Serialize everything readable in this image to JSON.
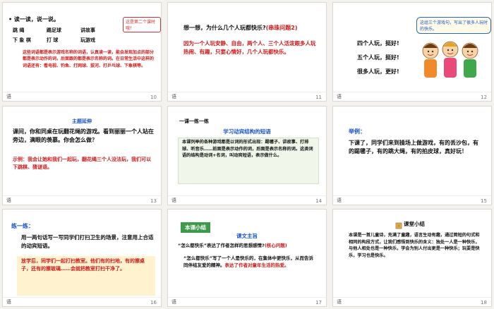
{
  "slides": [
    {
      "page": "10",
      "footer": "语",
      "heading": "• 读一读，说一说。",
      "corner_tag": "这是第二个课时哦！",
      "words_row1": [
        "跳 绳",
        "踢足球",
        "讲故事"
      ],
      "words_row2": [
        "下 象 棋",
        "打 球",
        "玩游戏"
      ],
      "explanation": "这些词语都是表示游戏名称的词语，认真读一读，能会发现加点的部分都是表示动作的词，后面跟的都是表示名称的词。在日常生活中这样的词语还有：看电视、钓鱼、打网球、拔河、打乒乓球、下象棋等。"
    },
    {
      "page": "11",
      "footer": "语",
      "question": "想一想，为什么几个人玩都快乐?",
      "question_tag": "(串珠问题2)",
      "answer": "因为一个人玩安静、自由，两个人、三个人活泼跟多人玩热闹、有趣，只要心情好，几个人玩都快乐。"
    },
    {
      "page": "12",
      "footer": "语",
      "bubble": "这组三个游戏句，写出了很多人玩时的快乐。",
      "lines": [
        "四个人玩，挺好!",
        "五个人玩，挺好!",
        "很多人玩，更好!"
      ]
    },
    {
      "page": "13",
      "footer": "语",
      "title": "主题延伸",
      "body": "课间，你和同桌在玩翻花绳的游戏。看到丽丽一个人站在旁边，满眼的羡慕。你会怎么做？",
      "example": "示例：我会让她和我们一起玩，翻花绳三个人没法玩，我们可以下跳棋、猜谜语。"
    },
    {
      "page": "14",
      "footer": "语",
      "strip": "一课一练一练",
      "title": "学习动宾结构的短语",
      "body": "本课列举的各种游戏都是以词的形式出现：踢毽子、讲故事、打排球、听音乐……前面是表示动作的词，后面是表示名称的词。这类词语的结构是动词+名词，叫动宾短语，表示做什么。"
    },
    {
      "page": "15",
      "footer": "语",
      "label": "举例：",
      "body": "下课了，同学们来到操场上做游戏，有的丢沙包，有的踢毽子，有的跳大绳，有的拍皮球，真好玩！"
    },
    {
      "page": "16",
      "footer": "语",
      "label": "练一练：",
      "prompt": "用一两句话写一写同学们打扫卫生的场景，注意用上合适的动宾短语。",
      "answer": "放学后，同学们一起打扫教室。他们有的扫地，有的擦桌子，还有的擦玻璃……会就把教室打扫干净了。"
    },
    {
      "page": "17",
      "footer": "语",
      "badge": "本课小结",
      "subtitle": "课文主旨",
      "question": "“怎么都快乐”表达了作者怎样的思想感情?",
      "question_tag": "(核心问题)",
      "answer_black": "“怎么都快乐”写了一个人是快乐的，在集体中更快乐，从而告诉同伴结友爱的精神。",
      "answer_red": "表达了作者对童年生活的热爱。"
    },
    {
      "page": "18",
      "footer": "语",
      "title": "课堂小结",
      "body": "本课是一首儿童诗，充满了童趣，语言生动有趣，通过简短的句式和相同的构段方式，让我们感悟到快乐的含义：独处一人是一种快乐，与他人相处也是一种快乐，学会为别人付出更是一种快乐；玩耍是快乐，学习也是快乐。"
    }
  ]
}
